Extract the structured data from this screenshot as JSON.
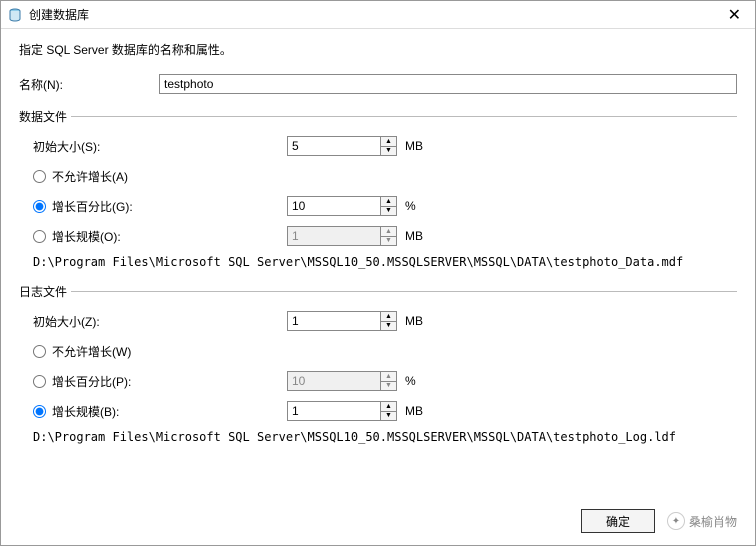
{
  "window": {
    "title": "创建数据库",
    "description": "指定 SQL Server 数据库的名称和属性。"
  },
  "name": {
    "label": "名称(N):",
    "value": "testphoto"
  },
  "data_file": {
    "legend": "数据文件",
    "initial_size_label": "初始大小(S):",
    "initial_size_value": "5",
    "initial_size_unit": "MB",
    "no_growth_label": "不允许增长(A)",
    "growth_percent_label": "增长百分比(G):",
    "growth_percent_value": "10",
    "growth_percent_unit": "%",
    "growth_scale_label": "增长规模(O):",
    "growth_scale_value": "1",
    "growth_scale_unit": "MB",
    "path": "D:\\Program Files\\Microsoft SQL Server\\MSSQL10_50.MSSQLSERVER\\MSSQL\\DATA\\testphoto_Data.mdf"
  },
  "log_file": {
    "legend": "日志文件",
    "initial_size_label": "初始大小(Z):",
    "initial_size_value": "1",
    "initial_size_unit": "MB",
    "no_growth_label": "不允许增长(W)",
    "growth_percent_label": "增长百分比(P):",
    "growth_percent_value": "10",
    "growth_percent_unit": "%",
    "growth_scale_label": "增长规模(B):",
    "growth_scale_value": "1",
    "growth_scale_unit": "MB",
    "path": "D:\\Program Files\\Microsoft SQL Server\\MSSQL10_50.MSSQLSERVER\\MSSQL\\DATA\\testphoto_Log.ldf"
  },
  "buttons": {
    "ok": "确定"
  },
  "watermark": {
    "text": "桑榆肖物"
  }
}
